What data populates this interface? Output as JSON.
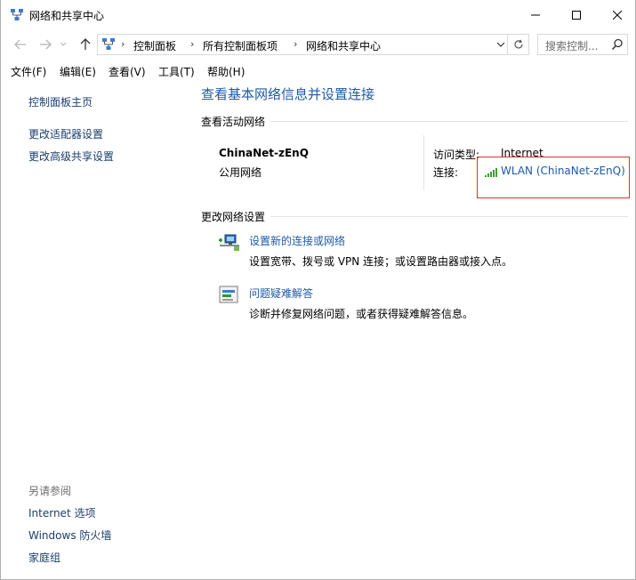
{
  "window": {
    "title": "网络和共享中心",
    "controls": {
      "minimize": "minimize",
      "maximize": "maximize",
      "close": "close"
    }
  },
  "address_bar": {
    "breadcrumbs": [
      "控制面板",
      "所有控制面板项",
      "网络和共享中心"
    ],
    "search_placeholder": "搜索控制..."
  },
  "menu": [
    {
      "label": "文件(F)"
    },
    {
      "label": "编辑(E)"
    },
    {
      "label": "查看(V)"
    },
    {
      "label": "工具(T)"
    },
    {
      "label": "帮助(H)"
    }
  ],
  "left_pane": {
    "links": [
      "控制面板主页",
      "更改适配器设置",
      "更改高级共享设置"
    ],
    "see_also_heading": "另请参阅",
    "see_also": [
      "Internet 选项",
      "Windows 防火墙",
      "家庭组"
    ]
  },
  "main": {
    "heading": "查看基本网络信息并设置连接",
    "active_networks_label": "查看活动网络",
    "network": {
      "name": "ChinaNet-zEnQ",
      "category": "公用网络",
      "access_type_label": "访问类型:",
      "access_type_value": "Internet",
      "connections_label": "连接:",
      "connection_link": "WLAN (ChinaNet-zEnQ)"
    },
    "change_settings_label": "更改网络设置",
    "tasks": [
      {
        "title": "设置新的连接或网络",
        "description": "设置宽带、拨号或 VPN 连接；或设置路由器或接入点。"
      },
      {
        "title": "问题疑难解答",
        "description": "诊断并修复网络问题，或者获得疑难解答信息。"
      }
    ]
  },
  "colors": {
    "link": "#1e5aa6",
    "nav_link": "#1a3e6e",
    "highlight_box": "#e03030",
    "muted": "#6d6d6d"
  }
}
